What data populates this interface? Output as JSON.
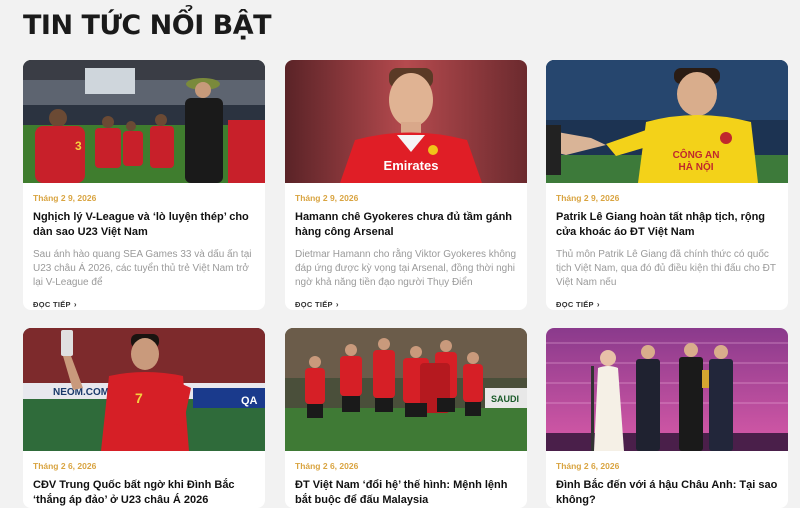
{
  "section": {
    "title": "TIN TỨC NỔI BẬT"
  },
  "articles": [
    {
      "date": "Tháng 2 9, 2026",
      "title": "Nghịch lý V-League và ‘lò luyện thép’ cho dàn sao U23 Việt Nam",
      "excerpt": "Sau ánh hào quang SEA Games 33 và dấu ấn tại U23 châu Á 2026, các tuyển thủ trẻ Việt Nam trở lại V-League để",
      "more": "ĐỌC TIẾP",
      "image": "u23-players-walking-out-stadium"
    },
    {
      "date": "Tháng 2 9, 2026",
      "title": "Hamann chê Gyokeres chưa đủ tầm gánh hàng công Arsenal",
      "excerpt": "Dietmar Hamann cho rằng Viktor Gyokeres không đáp ứng được kỳ vọng tại Arsenal, đồng thời nghi ngờ khả năng tiền đạo người Thụy Điển",
      "more": "ĐỌC TIẾP",
      "image": "arsenal-player-portrait",
      "shirt_text": "Emirates"
    },
    {
      "date": "Tháng 2 9, 2026",
      "title": "Patrik Lê Giang hoàn tất nhập tịch, rộng cửa khoác áo ĐT Việt Nam",
      "excerpt": "Thủ môn Patrik Lê Giang đã chính thức có quốc tịch Việt Nam, qua đó đủ điều kiện thi đấu cho ĐT Việt Nam nếu",
      "more": "ĐỌC TIẾP",
      "image": "goalkeeper-yellow-kit",
      "shirt_text_1": "CÔNG AN",
      "shirt_text_2": "HÀ NỘI"
    },
    {
      "date": "Tháng 2 6, 2026",
      "title": "CĐV Trung Quốc bất ngờ khi Đình Bắc ‘thắng áp đảo’ ở U23 châu Á 2026",
      "image": "player-selfie-stadium",
      "board_1": "NEOM.COM",
      "board_2": "QA",
      "shirt_number": "7"
    },
    {
      "date": "Tháng 2 6, 2026",
      "title": "ĐT Việt Nam ‘đổi hệ’ thế hình: Mệnh lệnh bắt buộc để đấu Malaysia",
      "image": "team-celebration-huddle",
      "board": "SAUDI"
    },
    {
      "date": "Tháng 2 6, 2026",
      "title": "Đình Bắc đến với á hậu Châu Anh: Tại sao không?",
      "image": "award-ceremony-stage"
    }
  ]
}
